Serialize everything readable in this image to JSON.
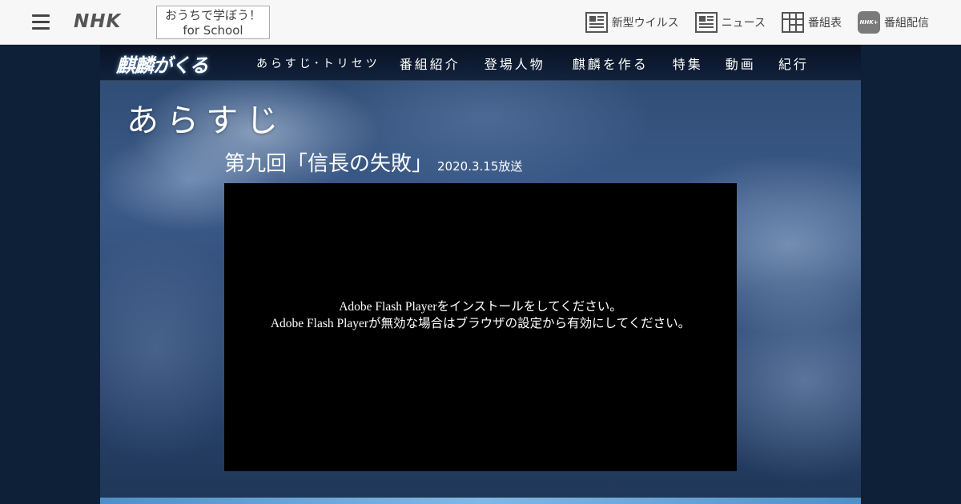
{
  "global_bar": {
    "logo": "NHK",
    "school_button": {
      "line1": "おうちで学ぼう！",
      "line2": "for School"
    },
    "right_nav": [
      {
        "label": "新型ウイルス",
        "icon": "news-article-icon"
      },
      {
        "label": "ニュース",
        "icon": "news-article-icon"
      },
      {
        "label": "番組表",
        "icon": "program-grid-icon"
      },
      {
        "label": "番組配信",
        "icon": "nhk-plus-icon",
        "badge": "NHK+"
      }
    ]
  },
  "program_nav": {
    "logo": "麒麟がくる",
    "items": [
      "あらすじ･トリセツ",
      "番組紹介",
      "登場人物",
      "麒麟を作る",
      "特集",
      "動画",
      "紀行"
    ]
  },
  "page": {
    "section_title": "あらすじ",
    "episode_title": "第九回「信長の失敗」",
    "episode_date": "2020.3.15放送"
  },
  "video": {
    "message_line1": "Adobe Flash Playerをインストールをしてください。",
    "message_line2": "Adobe Flash Playerが無効な場合はブラウザの設定から有効にしてください。"
  },
  "colors": {
    "page_bg": "#0d2038",
    "topbar_bg": "#f7f7f7",
    "accent_band": "#7fb8e6"
  }
}
